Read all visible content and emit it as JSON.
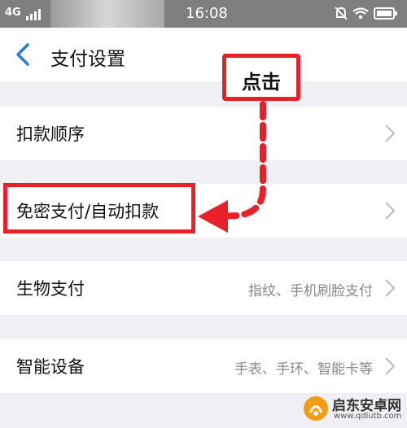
{
  "status_bar": {
    "network": "4G",
    "time": "16:08"
  },
  "header": {
    "title": "支付设置"
  },
  "rows": [
    {
      "label": "扣款顺序",
      "value": ""
    },
    {
      "label": "免密支付/自动扣款",
      "value": ""
    },
    {
      "label": "生物支付",
      "value": "指纹、手机刷脸支付"
    },
    {
      "label": "智能设备",
      "value": "手表、手环、智能卡等"
    }
  ],
  "annotation": {
    "callout": "点击",
    "color": "#e8202a"
  },
  "watermark": {
    "name": "启东安卓网",
    "url": "www.qdlutb.com"
  },
  "colors": {
    "background": "#efeff4",
    "accent": "#2a7ad5"
  }
}
